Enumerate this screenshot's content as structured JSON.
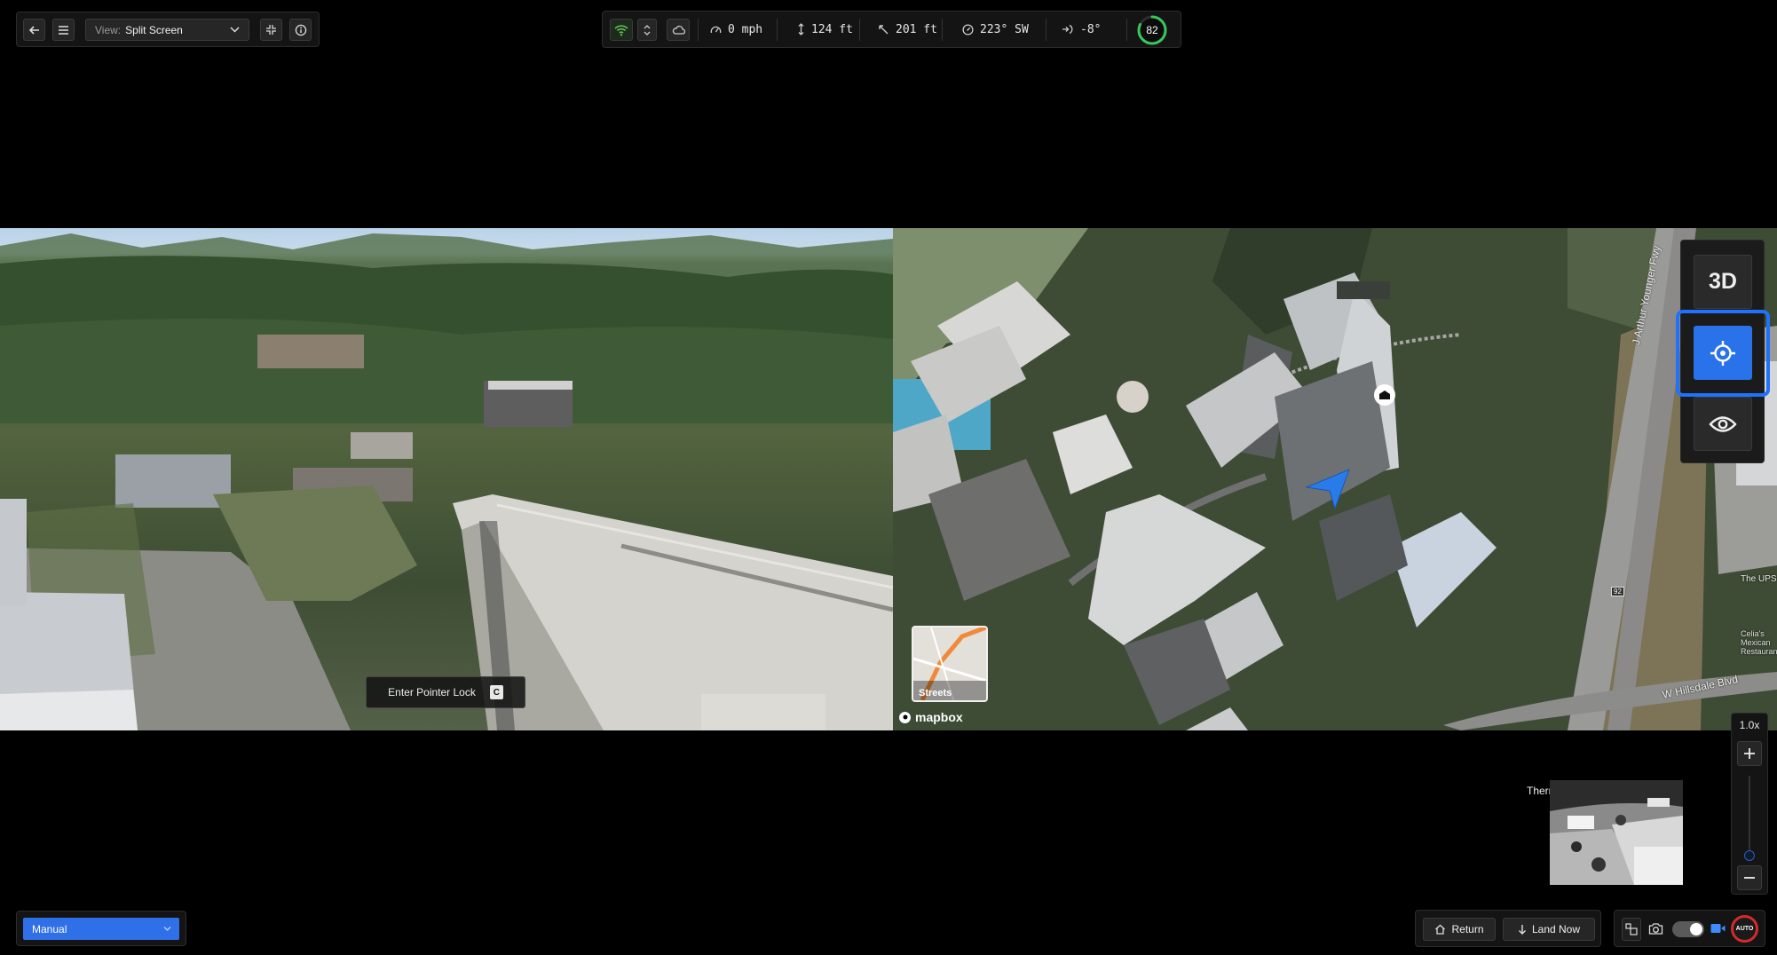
{
  "toolbar": {
    "view_prefix": "View:",
    "view_value": "Split Screen"
  },
  "telemetry": {
    "speed": "0 mph",
    "altitude": "124 ft",
    "distance": "201 ft",
    "heading": "223° SW",
    "pitch": "-8°",
    "battery": "82",
    "battery_fraction": 0.82,
    "signal_color": "#5ec24a",
    "battery_color": "#38c95b"
  },
  "video": {
    "pointer_lock_label": "Enter Pointer Lock",
    "pointer_lock_key": "C"
  },
  "map": {
    "view_3d_label": "3D",
    "style_label": "Streets",
    "attribution": "mapbox",
    "labels": {
      "freeway": "J Arthur Younger Fwy",
      "boulevard": "W Hillsdale Blvd",
      "ups": "The UPS",
      "restaurant": "Celia's Mexican Restaurant",
      "shield_1": "92",
      "shield_2": "92"
    },
    "drone_marker_color": "#2a7bea",
    "focus_color": "#1e72ff"
  },
  "zoom": {
    "level": "1.0x"
  },
  "thermal": {
    "label": "Thermal"
  },
  "mode": {
    "selected": "Manual",
    "color": "#2f6fe8"
  },
  "actions": {
    "return_label": "Return",
    "land_label": "Land Now"
  },
  "capture": {
    "auto_label": "AUTO",
    "record_color": "#d42a2a",
    "video_icon_color": "#3d8bff"
  }
}
